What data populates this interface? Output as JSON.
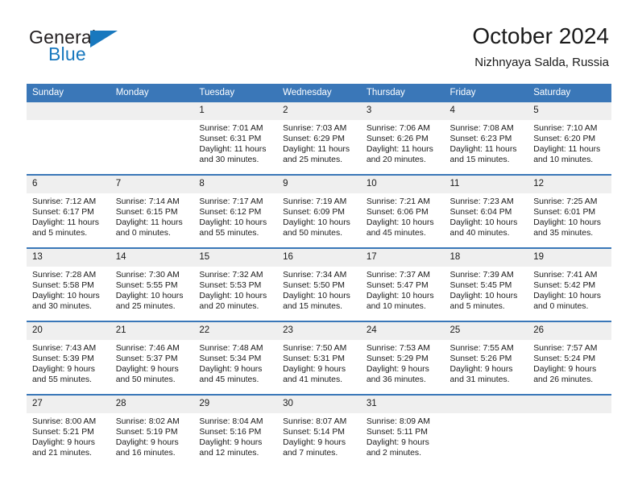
{
  "brand": {
    "name_part1": "General",
    "name_part2": "Blue"
  },
  "header": {
    "title": "October 2024",
    "location": "Nizhnyaya Salda, Russia"
  },
  "colors": {
    "header_blue": "#3a77b8",
    "brand_blue": "#1878be",
    "daynum_bg": "#efefef",
    "text": "#1a1a1a"
  },
  "weekdays": [
    "Sunday",
    "Monday",
    "Tuesday",
    "Wednesday",
    "Thursday",
    "Friday",
    "Saturday"
  ],
  "weeks": [
    [
      {
        "day": "",
        "blank": true
      },
      {
        "day": "",
        "blank": true
      },
      {
        "day": "1",
        "sunrise": "Sunrise: 7:01 AM",
        "sunset": "Sunset: 6:31 PM",
        "daylight_l1": "Daylight: 11 hours",
        "daylight_l2": "and 30 minutes."
      },
      {
        "day": "2",
        "sunrise": "Sunrise: 7:03 AM",
        "sunset": "Sunset: 6:29 PM",
        "daylight_l1": "Daylight: 11 hours",
        "daylight_l2": "and 25 minutes."
      },
      {
        "day": "3",
        "sunrise": "Sunrise: 7:06 AM",
        "sunset": "Sunset: 6:26 PM",
        "daylight_l1": "Daylight: 11 hours",
        "daylight_l2": "and 20 minutes."
      },
      {
        "day": "4",
        "sunrise": "Sunrise: 7:08 AM",
        "sunset": "Sunset: 6:23 PM",
        "daylight_l1": "Daylight: 11 hours",
        "daylight_l2": "and 15 minutes."
      },
      {
        "day": "5",
        "sunrise": "Sunrise: 7:10 AM",
        "sunset": "Sunset: 6:20 PM",
        "daylight_l1": "Daylight: 11 hours",
        "daylight_l2": "and 10 minutes."
      }
    ],
    [
      {
        "day": "6",
        "sunrise": "Sunrise: 7:12 AM",
        "sunset": "Sunset: 6:17 PM",
        "daylight_l1": "Daylight: 11 hours",
        "daylight_l2": "and 5 minutes."
      },
      {
        "day": "7",
        "sunrise": "Sunrise: 7:14 AM",
        "sunset": "Sunset: 6:15 PM",
        "daylight_l1": "Daylight: 11 hours",
        "daylight_l2": "and 0 minutes."
      },
      {
        "day": "8",
        "sunrise": "Sunrise: 7:17 AM",
        "sunset": "Sunset: 6:12 PM",
        "daylight_l1": "Daylight: 10 hours",
        "daylight_l2": "and 55 minutes."
      },
      {
        "day": "9",
        "sunrise": "Sunrise: 7:19 AM",
        "sunset": "Sunset: 6:09 PM",
        "daylight_l1": "Daylight: 10 hours",
        "daylight_l2": "and 50 minutes."
      },
      {
        "day": "10",
        "sunrise": "Sunrise: 7:21 AM",
        "sunset": "Sunset: 6:06 PM",
        "daylight_l1": "Daylight: 10 hours",
        "daylight_l2": "and 45 minutes."
      },
      {
        "day": "11",
        "sunrise": "Sunrise: 7:23 AM",
        "sunset": "Sunset: 6:04 PM",
        "daylight_l1": "Daylight: 10 hours",
        "daylight_l2": "and 40 minutes."
      },
      {
        "day": "12",
        "sunrise": "Sunrise: 7:25 AM",
        "sunset": "Sunset: 6:01 PM",
        "daylight_l1": "Daylight: 10 hours",
        "daylight_l2": "and 35 minutes."
      }
    ],
    [
      {
        "day": "13",
        "sunrise": "Sunrise: 7:28 AM",
        "sunset": "Sunset: 5:58 PM",
        "daylight_l1": "Daylight: 10 hours",
        "daylight_l2": "and 30 minutes."
      },
      {
        "day": "14",
        "sunrise": "Sunrise: 7:30 AM",
        "sunset": "Sunset: 5:55 PM",
        "daylight_l1": "Daylight: 10 hours",
        "daylight_l2": "and 25 minutes."
      },
      {
        "day": "15",
        "sunrise": "Sunrise: 7:32 AM",
        "sunset": "Sunset: 5:53 PM",
        "daylight_l1": "Daylight: 10 hours",
        "daylight_l2": "and 20 minutes."
      },
      {
        "day": "16",
        "sunrise": "Sunrise: 7:34 AM",
        "sunset": "Sunset: 5:50 PM",
        "daylight_l1": "Daylight: 10 hours",
        "daylight_l2": "and 15 minutes."
      },
      {
        "day": "17",
        "sunrise": "Sunrise: 7:37 AM",
        "sunset": "Sunset: 5:47 PM",
        "daylight_l1": "Daylight: 10 hours",
        "daylight_l2": "and 10 minutes."
      },
      {
        "day": "18",
        "sunrise": "Sunrise: 7:39 AM",
        "sunset": "Sunset: 5:45 PM",
        "daylight_l1": "Daylight: 10 hours",
        "daylight_l2": "and 5 minutes."
      },
      {
        "day": "19",
        "sunrise": "Sunrise: 7:41 AM",
        "sunset": "Sunset: 5:42 PM",
        "daylight_l1": "Daylight: 10 hours",
        "daylight_l2": "and 0 minutes."
      }
    ],
    [
      {
        "day": "20",
        "sunrise": "Sunrise: 7:43 AM",
        "sunset": "Sunset: 5:39 PM",
        "daylight_l1": "Daylight: 9 hours",
        "daylight_l2": "and 55 minutes."
      },
      {
        "day": "21",
        "sunrise": "Sunrise: 7:46 AM",
        "sunset": "Sunset: 5:37 PM",
        "daylight_l1": "Daylight: 9 hours",
        "daylight_l2": "and 50 minutes."
      },
      {
        "day": "22",
        "sunrise": "Sunrise: 7:48 AM",
        "sunset": "Sunset: 5:34 PM",
        "daylight_l1": "Daylight: 9 hours",
        "daylight_l2": "and 45 minutes."
      },
      {
        "day": "23",
        "sunrise": "Sunrise: 7:50 AM",
        "sunset": "Sunset: 5:31 PM",
        "daylight_l1": "Daylight: 9 hours",
        "daylight_l2": "and 41 minutes."
      },
      {
        "day": "24",
        "sunrise": "Sunrise: 7:53 AM",
        "sunset": "Sunset: 5:29 PM",
        "daylight_l1": "Daylight: 9 hours",
        "daylight_l2": "and 36 minutes."
      },
      {
        "day": "25",
        "sunrise": "Sunrise: 7:55 AM",
        "sunset": "Sunset: 5:26 PM",
        "daylight_l1": "Daylight: 9 hours",
        "daylight_l2": "and 31 minutes."
      },
      {
        "day": "26",
        "sunrise": "Sunrise: 7:57 AM",
        "sunset": "Sunset: 5:24 PM",
        "daylight_l1": "Daylight: 9 hours",
        "daylight_l2": "and 26 minutes."
      }
    ],
    [
      {
        "day": "27",
        "sunrise": "Sunrise: 8:00 AM",
        "sunset": "Sunset: 5:21 PM",
        "daylight_l1": "Daylight: 9 hours",
        "daylight_l2": "and 21 minutes."
      },
      {
        "day": "28",
        "sunrise": "Sunrise: 8:02 AM",
        "sunset": "Sunset: 5:19 PM",
        "daylight_l1": "Daylight: 9 hours",
        "daylight_l2": "and 16 minutes."
      },
      {
        "day": "29",
        "sunrise": "Sunrise: 8:04 AM",
        "sunset": "Sunset: 5:16 PM",
        "daylight_l1": "Daylight: 9 hours",
        "daylight_l2": "and 12 minutes."
      },
      {
        "day": "30",
        "sunrise": "Sunrise: 8:07 AM",
        "sunset": "Sunset: 5:14 PM",
        "daylight_l1": "Daylight: 9 hours",
        "daylight_l2": "and 7 minutes."
      },
      {
        "day": "31",
        "sunrise": "Sunrise: 8:09 AM",
        "sunset": "Sunset: 5:11 PM",
        "daylight_l1": "Daylight: 9 hours",
        "daylight_l2": "and 2 minutes."
      },
      {
        "day": "",
        "blank": true
      },
      {
        "day": "",
        "blank": true
      }
    ]
  ]
}
